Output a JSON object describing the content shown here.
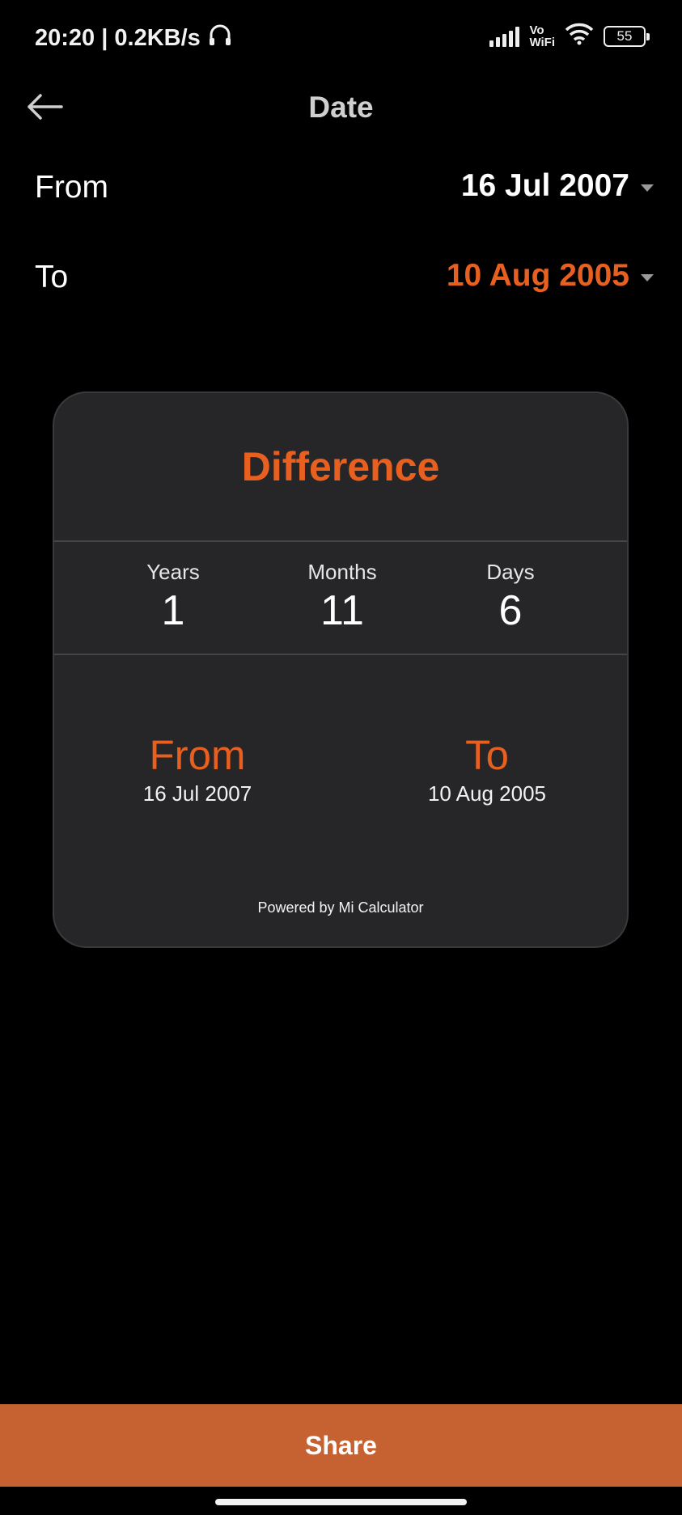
{
  "status_bar": {
    "time_speed": "20:20 | 0.2KB/s",
    "vowifi_top": "Vo",
    "vowifi_bottom": "WiFi",
    "battery": "55"
  },
  "header": {
    "title": "Date"
  },
  "from_row": {
    "label": "From",
    "value": "16 Jul 2007",
    "color": "#ffffff"
  },
  "to_row": {
    "label": "To",
    "value": "10 Aug 2005",
    "color": "#e8601f"
  },
  "card": {
    "title": "Difference",
    "stats": [
      {
        "label": "Years",
        "value": "1"
      },
      {
        "label": "Months",
        "value": "11"
      },
      {
        "label": "Days",
        "value": "6"
      }
    ],
    "from": {
      "label": "From",
      "date": "16 Jul 2007"
    },
    "to": {
      "label": "To",
      "date": "10 Aug 2005"
    },
    "powered_by": "Powered by Mi Calculator"
  },
  "share": {
    "label": "Share"
  },
  "colors": {
    "accent": "#e8601f",
    "share_bg": "#c66232",
    "card_bg": "#262628"
  },
  "icons": [
    "headset-icon",
    "signal-icon",
    "wifi-icon",
    "battery-icon",
    "back-arrow-icon",
    "dropdown-caret-icon"
  ]
}
